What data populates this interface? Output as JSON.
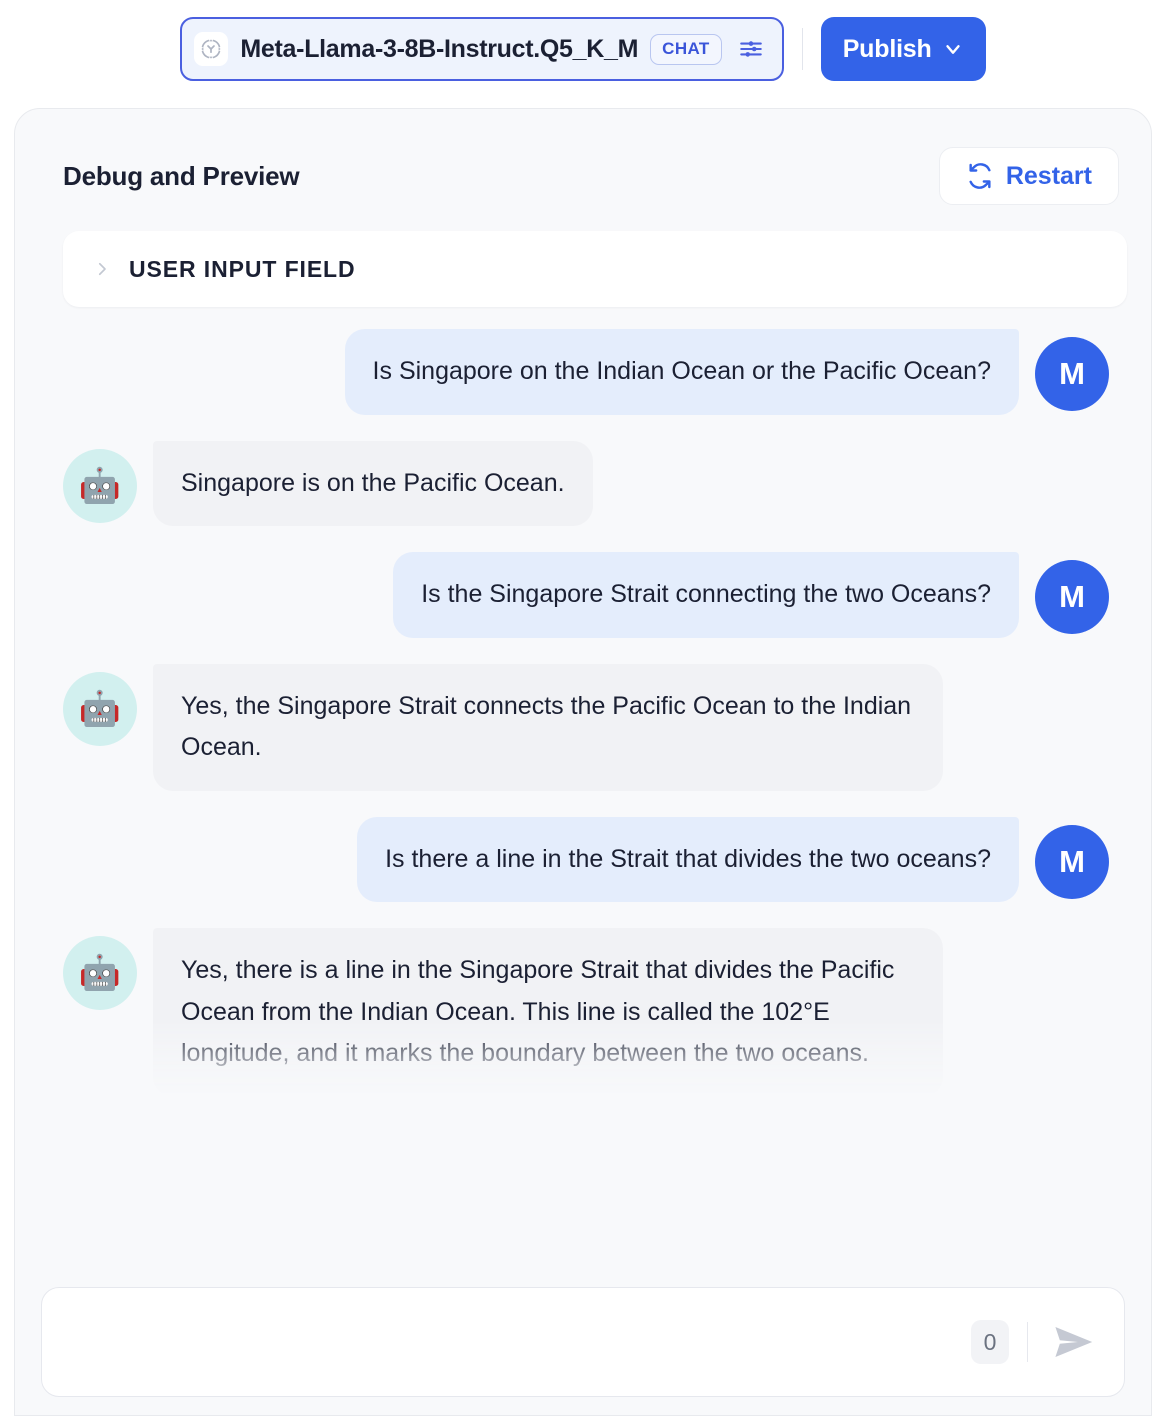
{
  "topbar": {
    "model_icon": "model-3d-icon",
    "model_name": "Meta-Llama-3-8B-Instruct.Q5_K_M",
    "chat_badge": "CHAT",
    "tune_icon": "sliders-icon",
    "publish_label": "Publish",
    "publish_chevron": "chevron-down-icon",
    "accent_color": "#3363e8"
  },
  "panel": {
    "title": "Debug and Preview",
    "restart_label": "Restart",
    "restart_icon": "refresh-icon"
  },
  "user_input_field": {
    "label": "USER INPUT FIELD",
    "chevron": "chevron-right-icon"
  },
  "chat": {
    "user_avatar_initial": "M",
    "bot_avatar_emoji": "🤖",
    "messages": [
      {
        "role": "user",
        "text": "Is Singapore on the Indian Ocean or the Pacific Ocean?"
      },
      {
        "role": "bot",
        "text": "Singapore is on the Pacific Ocean."
      },
      {
        "role": "user",
        "text": "Is the Singapore Strait connecting the two Oceans?"
      },
      {
        "role": "bot",
        "text": "Yes, the Singapore Strait connects the Pacific Ocean to the Indian Ocean."
      },
      {
        "role": "user",
        "text": "Is there a line in the Strait that divides the two oceans?"
      },
      {
        "role": "bot",
        "text": "Yes, there is a line in the Singapore Strait that divides the Pacific Ocean from the Indian Ocean. This line is called the 102°E longitude, and it marks the boundary between the two oceans."
      }
    ]
  },
  "composer": {
    "value": "",
    "placeholder": "",
    "char_count": "0",
    "send_icon": "send-icon"
  }
}
